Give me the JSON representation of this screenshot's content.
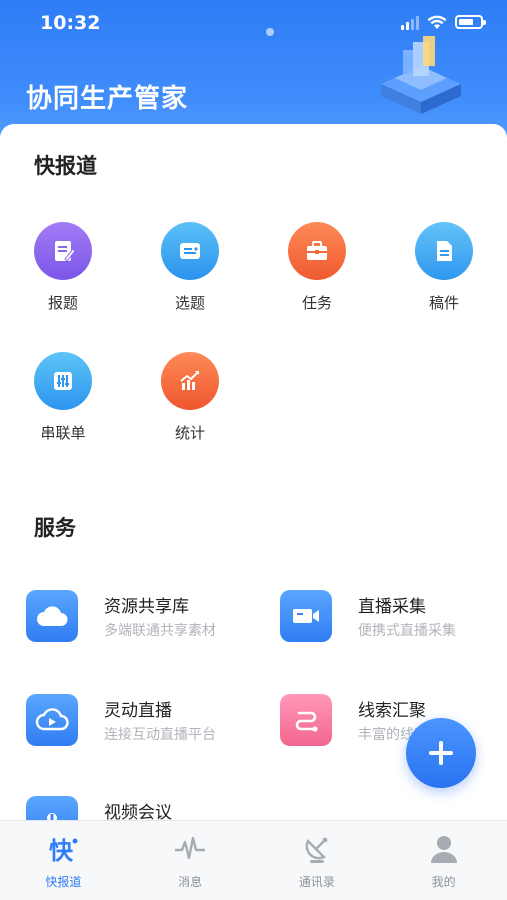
{
  "status_bar": {
    "time": "10:32"
  },
  "header": {
    "app_title": "协同生产管家"
  },
  "quick_report": {
    "title": "快报道",
    "items": [
      {
        "label": "报题",
        "icon": "report-topic-icon",
        "color": "#8f6cf0"
      },
      {
        "label": "选题",
        "icon": "select-topic-icon",
        "color": "#33a3f0"
      },
      {
        "label": "任务",
        "icon": "briefcase-icon",
        "color": "#f46a3f"
      },
      {
        "label": "稿件",
        "icon": "document-icon",
        "color": "#35a0f2"
      },
      {
        "label": "串联单",
        "icon": "sliders-icon",
        "color": "#32a6f0"
      },
      {
        "label": "统计",
        "icon": "chart-icon",
        "color": "#f4673d"
      }
    ]
  },
  "services": {
    "title": "服务",
    "items": [
      {
        "title": "资源共享库",
        "subtitle": "多端联通共享素材",
        "icon": "cloud-icon",
        "color": "#3a8ef5"
      },
      {
        "title": "直播采集",
        "subtitle": "便携式直播采集",
        "icon": "video-camera-icon",
        "color": "#3a8ef5"
      },
      {
        "title": "灵动直播",
        "subtitle": "连接互动直播平台",
        "icon": "cloud-play-icon",
        "color": "#3a8ef5"
      },
      {
        "title": "线索汇聚",
        "subtitle": "丰富的线索资讯",
        "icon": "route-icon",
        "color": "#f57aa0"
      },
      {
        "title": "视频会议",
        "subtitle": "",
        "icon": "meeting-icon",
        "color": "#3a8ef5"
      }
    ]
  },
  "tabbar": {
    "tabs": [
      {
        "label": "快报道",
        "active": true
      },
      {
        "label": "消息",
        "active": false
      },
      {
        "label": "通讯录",
        "active": false
      },
      {
        "label": "我的",
        "active": false
      }
    ]
  },
  "colors": {
    "primary": "#2f7df6",
    "fab": "#3b86f8"
  }
}
